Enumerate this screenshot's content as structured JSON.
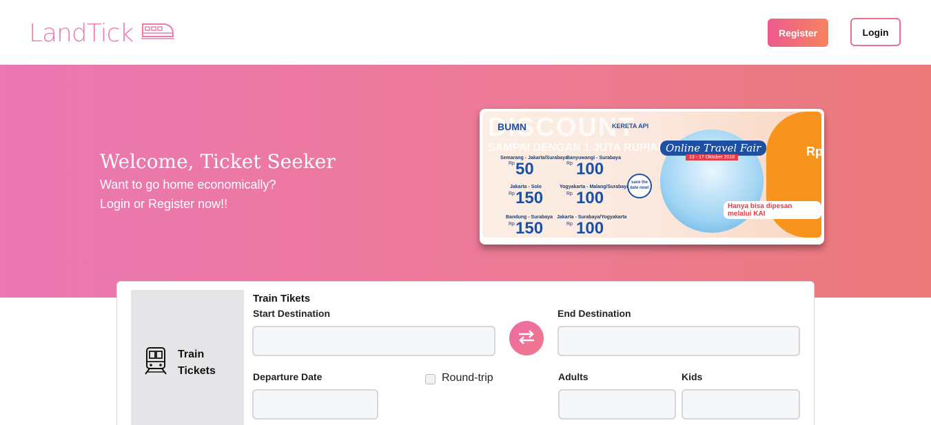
{
  "header": {
    "logo_text": "LandTick",
    "register_label": "Register",
    "login_label": "Login"
  },
  "hero": {
    "title": "Welcome, Ticket Seeker",
    "subtitle_line1": "Want to go home economically?",
    "subtitle_line2": "Login or Register now!!"
  },
  "banner": {
    "headline": "DISCOUNT",
    "subline": "SAMPAI DENGAN 1 JUTA RUPIAH",
    "bumn": "BUMN",
    "kereta_api": "KERETA API",
    "travel_fair": "Online Travel Fair",
    "fair_dates": "13 - 17 Oktober 2018",
    "save_date": "save the date now!",
    "note": "Hanya bisa dipesan melalui KAI",
    "rp_big": "Rp",
    "routes": [
      {
        "route": "Semarang - Jakarta/Surabaya",
        "price": "50"
      },
      {
        "route": "Banyuwangi - Surabaya",
        "price": "100"
      },
      {
        "route": "Jakarta - Solo",
        "price": "150"
      },
      {
        "route": "Yogyakarta - Malang/Surabaya",
        "price": "100"
      },
      {
        "route": "Bandung - Surabaya",
        "price": "150"
      },
      {
        "route": "Jakarta - Surabaya/Yogyakarta",
        "price": "100"
      }
    ],
    "currency_prefix": "Rp"
  },
  "form": {
    "tab_label_line1": "Train",
    "tab_label_line2": "Tickets",
    "section_title": "Train Tikets",
    "start_label": "Start Destination",
    "end_label": "End Destination",
    "departure_label": "Departure Date",
    "roundtrip_label": "Round-trip",
    "adults_label": "Adults",
    "kids_label": "Kids",
    "start_value": "",
    "end_value": "",
    "departure_value": "",
    "adults_value": "",
    "kids_value": ""
  },
  "icons": {
    "logo_train": "train-logo-icon",
    "train_tab": "train-icon",
    "swap": "swap-arrows-icon"
  },
  "colors": {
    "brand_pink": "#ec7ab0",
    "gradient_start": "#ec5a8f",
    "gradient_end": "#f7845f",
    "hero_left": "#eb77b3",
    "hero_right": "#ec7a7a"
  }
}
